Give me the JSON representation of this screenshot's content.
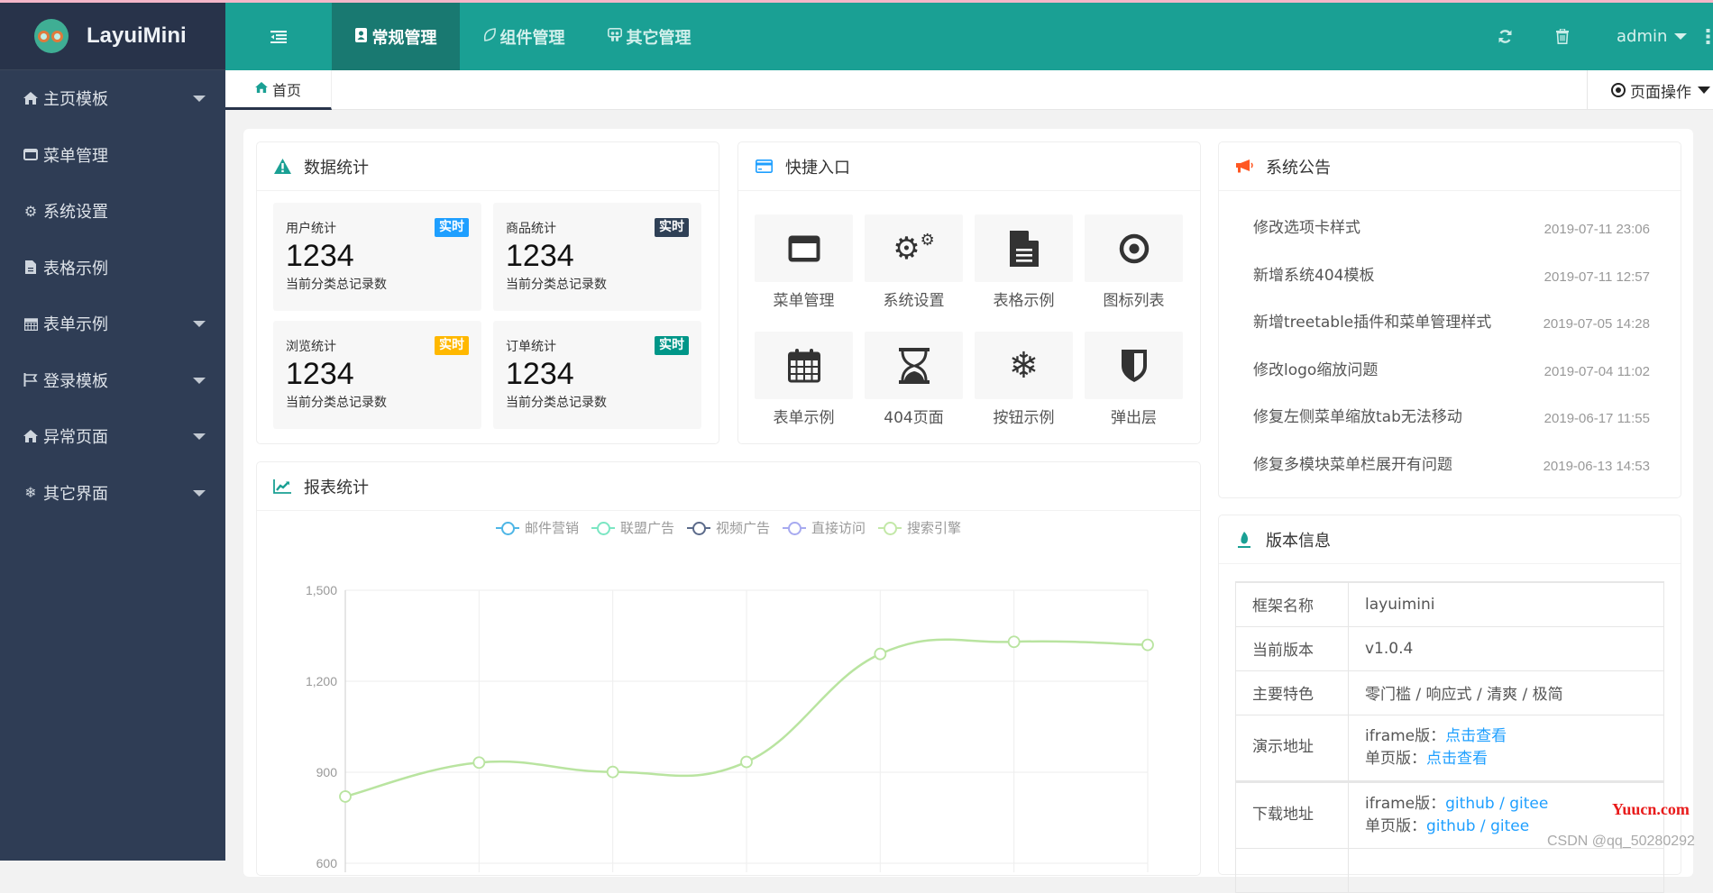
{
  "app": {
    "logo_text": "LayuiMini"
  },
  "sidebar": {
    "items": [
      {
        "label": "主页模板",
        "icon": "home-icon",
        "has_children": true
      },
      {
        "label": "菜单管理",
        "icon": "window-icon",
        "has_children": false
      },
      {
        "label": "系统设置",
        "icon": "gears-icon",
        "has_children": false
      },
      {
        "label": "表格示例",
        "icon": "file-icon",
        "has_children": false
      },
      {
        "label": "表单示例",
        "icon": "calendar-icon",
        "has_children": true
      },
      {
        "label": "登录模板",
        "icon": "flag-icon",
        "has_children": true
      },
      {
        "label": "异常页面",
        "icon": "home-icon",
        "has_children": true
      },
      {
        "label": "其它界面",
        "icon": "snowflake-icon",
        "has_children": true
      }
    ]
  },
  "header": {
    "modules": [
      {
        "label": "常规管理",
        "icon": "address-book-icon",
        "active": true
      },
      {
        "label": "组件管理",
        "icon": "leaf-icon",
        "active": false
      },
      {
        "label": "其它管理",
        "icon": "slideshare-icon",
        "active": false
      }
    ],
    "user": "admin"
  },
  "tabs": {
    "home_label": "首页",
    "page_ops_label": "页面操作"
  },
  "stats_card": {
    "title": "数据统计",
    "items": [
      {
        "title": "用户统计",
        "badge": "实时",
        "badge_color": "#1e9fff",
        "value": "1234",
        "desc": "当前分类总记录数"
      },
      {
        "title": "商品统计",
        "badge": "实时",
        "badge_color": "#2f4056",
        "value": "1234",
        "desc": "当前分类总记录数"
      },
      {
        "title": "浏览统计",
        "badge": "实时",
        "badge_color": "#ffb800",
        "value": "1234",
        "desc": "当前分类总记录数"
      },
      {
        "title": "订单统计",
        "badge": "实时",
        "badge_color": "#009688",
        "value": "1234",
        "desc": "当前分类总记录数"
      }
    ]
  },
  "quick_card": {
    "title": "快捷入口",
    "items": [
      {
        "label": "菜单管理",
        "icon": "window-icon"
      },
      {
        "label": "系统设置",
        "icon": "gears-icon"
      },
      {
        "label": "表格示例",
        "icon": "file-text-icon"
      },
      {
        "label": "图标列表",
        "icon": "dot-circle-icon"
      },
      {
        "label": "表单示例",
        "icon": "calendar-icon"
      },
      {
        "label": "404页面",
        "icon": "hourglass-icon"
      },
      {
        "label": "按钮示例",
        "icon": "snowflake-icon"
      },
      {
        "label": "弹出层",
        "icon": "shield-icon"
      }
    ]
  },
  "notice_card": {
    "title": "系统公告",
    "items": [
      {
        "title": "修改选项卡样式",
        "time": "2019-07-11 23:06"
      },
      {
        "title": "新增系统404模板",
        "time": "2019-07-11 12:57"
      },
      {
        "title": "新增treetable插件和菜单管理样式",
        "time": "2019-07-05 14:28"
      },
      {
        "title": "修改logo缩放问题",
        "time": "2019-07-04 11:02"
      },
      {
        "title": "修复左侧菜单缩放tab无法移动",
        "time": "2019-06-17 11:55"
      },
      {
        "title": "修复多模块菜单栏展开有问题",
        "time": "2019-06-13 14:53"
      }
    ]
  },
  "version_card": {
    "title": "版本信息",
    "rows": {
      "name_key": "框架名称",
      "name_val": "layuimini",
      "version_key": "当前版本",
      "version_val": "v1.0.4",
      "feature_key": "主要特色",
      "feature_val": "零门槛 / 响应式 / 清爽 / 极简",
      "demo_key": "演示地址",
      "demo_iframe_label": "iframe版：",
      "demo_iframe_link": "点击查看",
      "demo_single_label": "单页版：",
      "demo_single_link": "点击查看",
      "download_key": "下载地址",
      "dl_iframe_label": "iframe版：",
      "dl_single_label": "单页版：",
      "github": "github",
      "sep": " / ",
      "gitee": "gitee"
    }
  },
  "report_card": {
    "title": "报表统计"
  },
  "chart_data": {
    "type": "line",
    "title": "报表统计",
    "legend": [
      "邮件营销",
      "联盟广告",
      "视频广告",
      "直接访问",
      "搜索引擎"
    ],
    "legend_colors": [
      "#4eb6e6",
      "#7be6c3",
      "#5b6a8a",
      "#a7aaf0",
      "#c3e8a8"
    ],
    "legend_position": "top-center",
    "visible_series": [
      {
        "name": "搜索引擎",
        "color": "#b9e4a0",
        "values": [
          820,
          932,
          901,
          934,
          1290,
          1330,
          1320
        ]
      }
    ],
    "y_ticks": [
      "1,500",
      "1,200",
      "900",
      "600"
    ],
    "ylim": [
      600,
      1500
    ],
    "grid": true,
    "smooth": true
  },
  "watermarks": {
    "site": "Yuucn.com",
    "csdn": "CSDN @qq_50280292"
  }
}
